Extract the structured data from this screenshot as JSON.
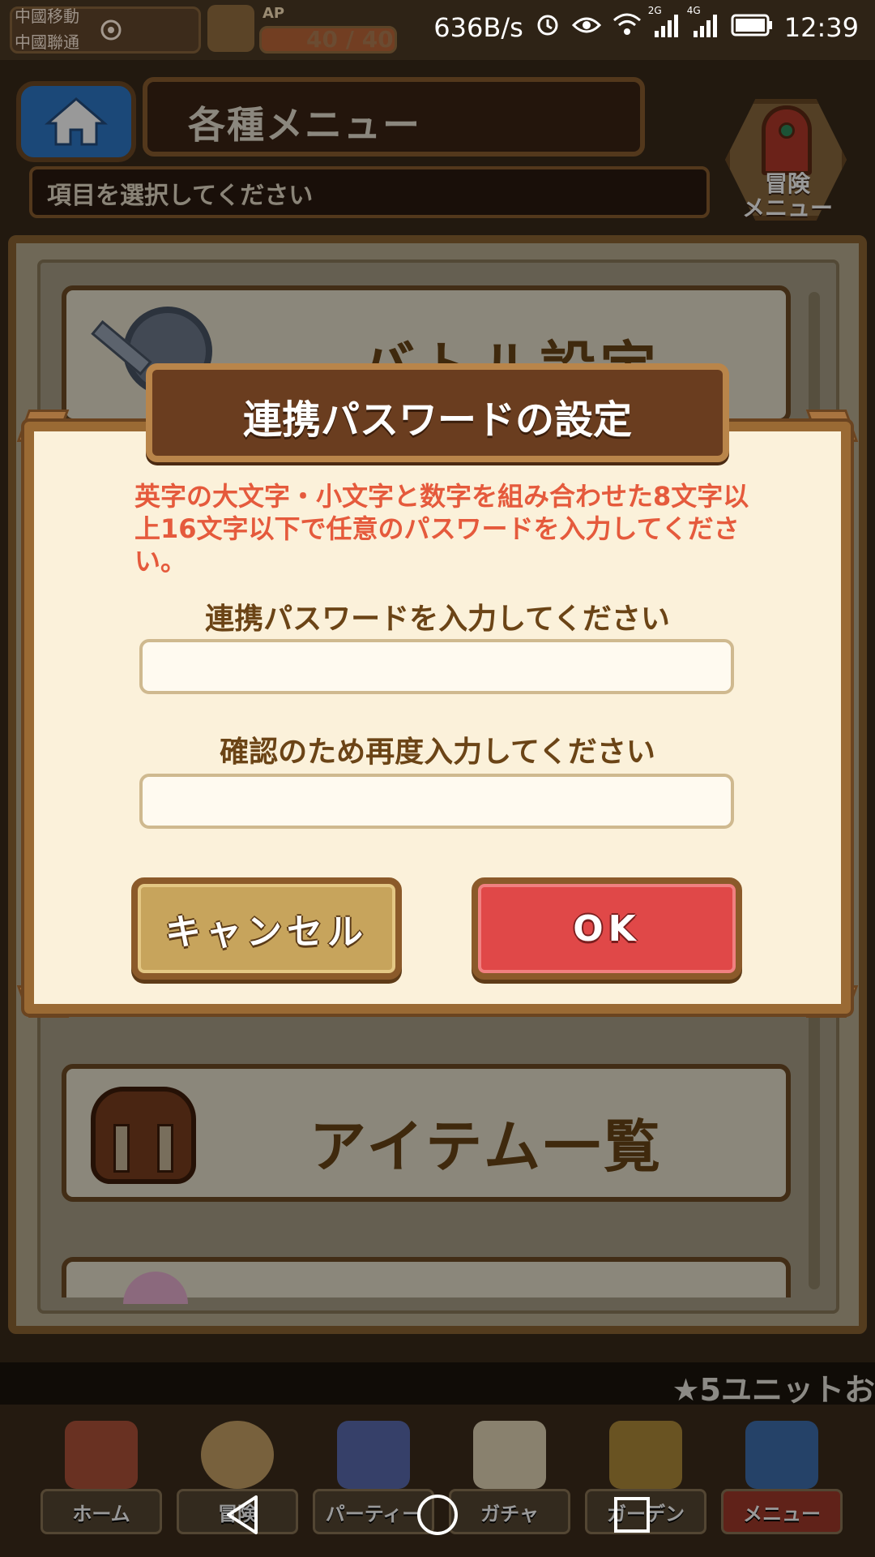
{
  "status_bar": {
    "carrier_1": "中國移動",
    "carrier_2": "中國聯通",
    "net_speed": "636B/s",
    "network_1": "2G",
    "network_2": "4G",
    "time": "12:39"
  },
  "hud": {
    "ap_label": "AP",
    "ap_value": "40 / 40"
  },
  "header": {
    "title": "各種メニュー",
    "subtitle": "項目を選択してください",
    "adventure_menu_label": "冒険\nメニュー"
  },
  "menu": {
    "items": [
      {
        "label": "バトル設定"
      },
      {
        "label": "アイテム一覧"
      }
    ]
  },
  "ticker": {
    "text": "★5ユニットお"
  },
  "game_nav": {
    "items": [
      {
        "label": "ホーム"
      },
      {
        "label": "冒険"
      },
      {
        "label": "パーティー"
      },
      {
        "label": "ガチャ"
      },
      {
        "label": "ガーデン"
      },
      {
        "label": "メニュー"
      }
    ]
  },
  "dialog": {
    "title": "連携パスワードの設定",
    "description": "英字の大文字・小文字と数字を組み合わせた8文字以上16文字以下で任意のパスワードを入力してください。",
    "password_label": "連携パスワードを入力してください",
    "password_value": "",
    "confirm_label": "確認のため再度入力してください",
    "confirm_value": "",
    "cancel_label": "キャンセル",
    "ok_label": "OK"
  },
  "colors": {
    "dialog_background": "#fbf1da",
    "description_text": "#e55a3c",
    "ok_button": "#e04848",
    "cancel_button": "#c7a45c",
    "home_button": "#2d79c9"
  }
}
